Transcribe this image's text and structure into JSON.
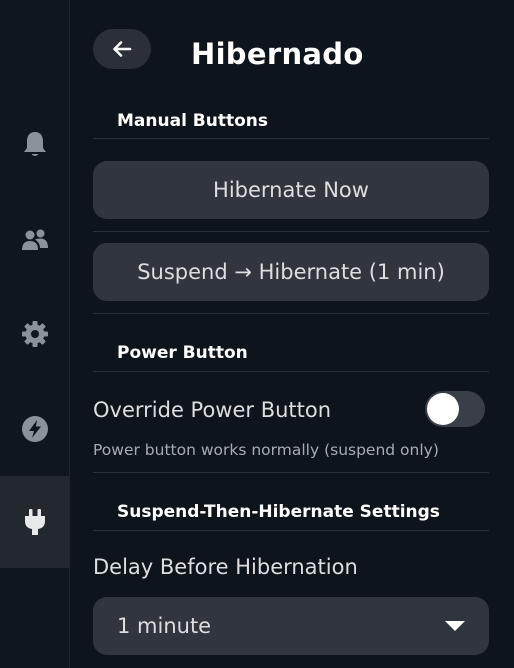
{
  "sidebar": {
    "items": [
      {
        "icon": "bell-icon",
        "active": false
      },
      {
        "icon": "friends-icon",
        "active": false
      },
      {
        "icon": "gear-icon",
        "active": false
      },
      {
        "icon": "lightning-icon",
        "active": false
      },
      {
        "icon": "plug-icon",
        "active": true
      }
    ]
  },
  "header": {
    "back_icon": "arrow-left-icon",
    "title": "Hibernado"
  },
  "manual": {
    "header": "Manual Buttons",
    "hibernate_now": "Hibernate Now",
    "suspend_hibernate": "Suspend → Hibernate (1 min)"
  },
  "power": {
    "header": "Power Button",
    "override_label": "Override Power Button",
    "override_enabled": false,
    "description": "Power button works normally (suspend only)"
  },
  "sth": {
    "header": "Suspend-Then-Hibernate Settings",
    "delay_label": "Delay Before Hibernation",
    "delay_value": "1 minute"
  },
  "colors": {
    "background": "#0e141b",
    "button": "#31363e",
    "text": "#dcdedf",
    "active_rail": "#23272e"
  }
}
